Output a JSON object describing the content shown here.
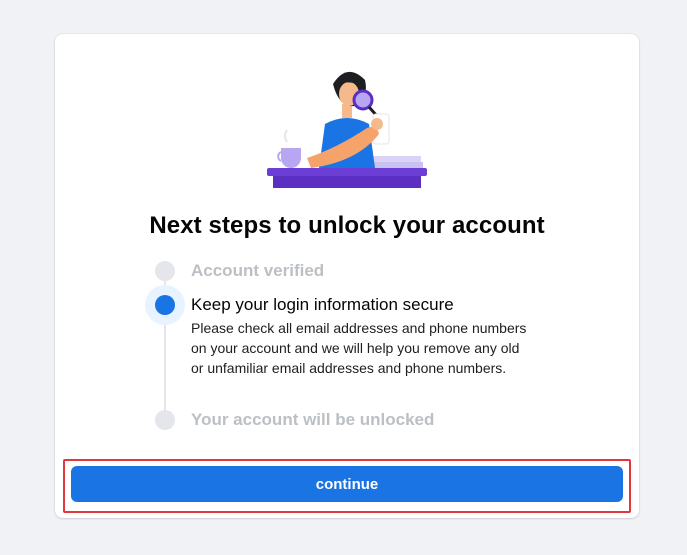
{
  "title": "Next steps to unlock your account",
  "steps": [
    {
      "label": "Account verified",
      "state": "done"
    },
    {
      "label": "Keep your login information secure",
      "state": "current",
      "description": "Please check all email addresses and phone numbers on your account and we will help you remove any old or unfamiliar email addresses and phone numbers."
    },
    {
      "label": "Your account will be unlocked",
      "state": "pending"
    }
  ],
  "continue_label": "continue",
  "colors": {
    "accent": "#1b74e4",
    "page_background": "#f0f2f5",
    "highlight": "#e0383e",
    "inactive": "#bcc0c4"
  },
  "illustration": {
    "icon": "person-with-magnifier-illustration"
  }
}
